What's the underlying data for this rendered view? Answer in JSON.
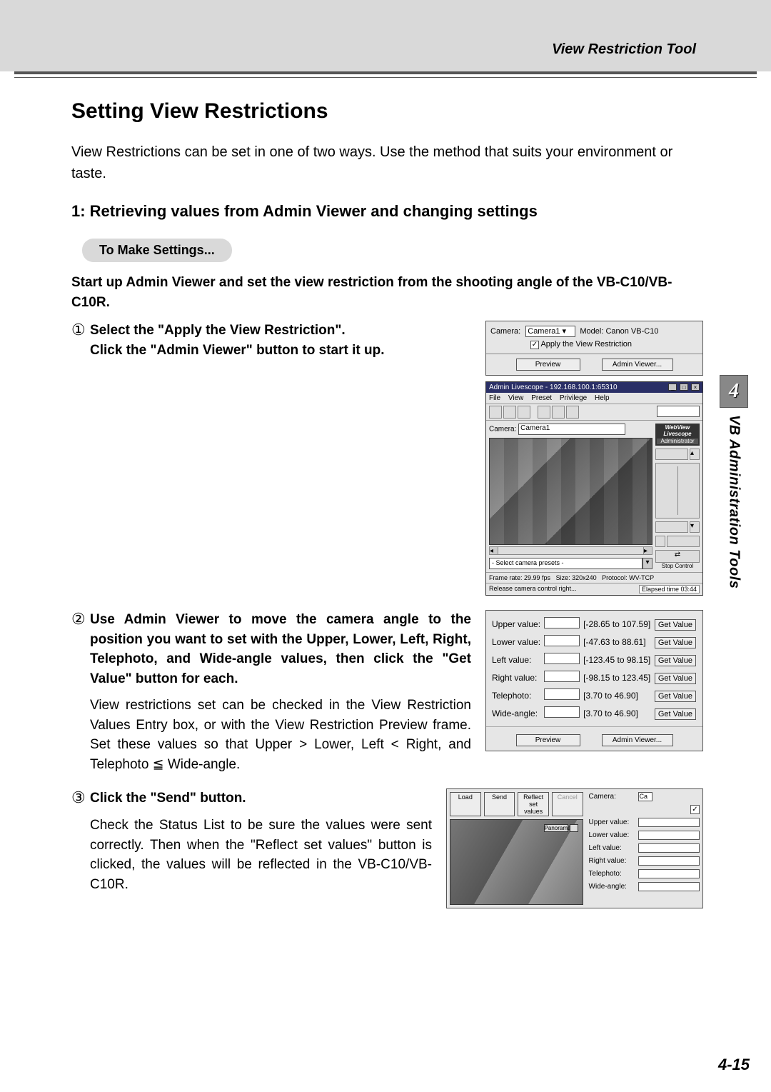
{
  "header": {
    "tool_title": "View Restriction Tool"
  },
  "sidetab": {
    "chapter_num": "4",
    "chapter_title": "VB Administration Tools"
  },
  "footer": {
    "page": "4-15"
  },
  "title": "Setting View Restrictions",
  "intro": "View Restrictions can be set in one of two ways. Use the method that suits your environment or taste.",
  "sub1": "1: Retrieving values from Admin Viewer and changing settings",
  "pill": "To Make Settings...",
  "startup": "Start up Admin Viewer and set the view restriction from the shooting angle of the VB-C10/VB-C10R.",
  "step1": {
    "num": "①",
    "line1": "Select the \"Apply the View Restriction\".",
    "line2": "Click the \"Admin Viewer\" button to start it up."
  },
  "step2": {
    "num": "②",
    "bold": "Use Admin Viewer to move the camera angle to the position you want to set with the Upper, Lower, Left, Right, Telephoto, and Wide-angle values, then click the \"Get Value\" button for each.",
    "body": "View restrictions set can be checked in the View Restriction Values Entry box, or with the View Restriction Preview frame. Set these values so that Upper > Lower, Left < Right, and Telephoto ≦ Wide-angle."
  },
  "step3": {
    "num": "③",
    "bold": "Click the \"Send\" button.",
    "body": "Check the Status List to be sure the values were sent correctly. Then when the \"Reflect set values\" button is clicked, the values will be reflected in the VB-C10/VB-C10R."
  },
  "panel1": {
    "camera_label": "Camera:",
    "camera_value": "Camera1",
    "model_label": "Model: Canon VB-C10",
    "apply_label": "Apply the View Restriction",
    "preview": "Preview",
    "admin": "Admin Viewer..."
  },
  "livescope": {
    "title": "Admin Livescope - 192.168.100.1:65310",
    "menu": [
      "File",
      "View",
      "Preset",
      "Privilege",
      "Help"
    ],
    "camera_label": "Camera:",
    "camera_value": "Camera1",
    "brand1": "WebView",
    "brand2": "Livescope",
    "brand3": "Administrator",
    "preset_placeholder": "- Select camera presets -",
    "stop": "Stop Control",
    "status_fr": "Frame rate: 29.99 fps",
    "status_sz": "Size: 320x240",
    "status_pr": "Protocol: WV-TCP",
    "status_rel": "Release camera control right...",
    "status_elapsed": "Elapsed time 03:44"
  },
  "values": {
    "rows": [
      {
        "label": "Upper value:",
        "range": "[-28.65 to 107.59]"
      },
      {
        "label": "Lower value:",
        "range": "[-47.63 to 88.61]"
      },
      {
        "label": "Left value:",
        "range": "[-123.45 to 98.15]"
      },
      {
        "label": "Right value:",
        "range": "[-98.15 to 123.45]"
      },
      {
        "label": "Telephoto:",
        "range": "[3.70 to 46.90]"
      },
      {
        "label": "Wide-angle:",
        "range": "[3.70 to 46.90]"
      }
    ],
    "getvalue": "Get Value",
    "preview": "Preview",
    "admin": "Admin Viewer..."
  },
  "send": {
    "load": "Load",
    "send": "Send",
    "reflect": "Reflect set values",
    "cancel": "Cancel",
    "panorama": "Panorama...",
    "camera_label": "Camera:",
    "camera_short": "Ca",
    "labels": [
      "Upper value:",
      "Lower value:",
      "Left value:",
      "Right value:",
      "Telephoto:",
      "Wide-angle:"
    ]
  }
}
